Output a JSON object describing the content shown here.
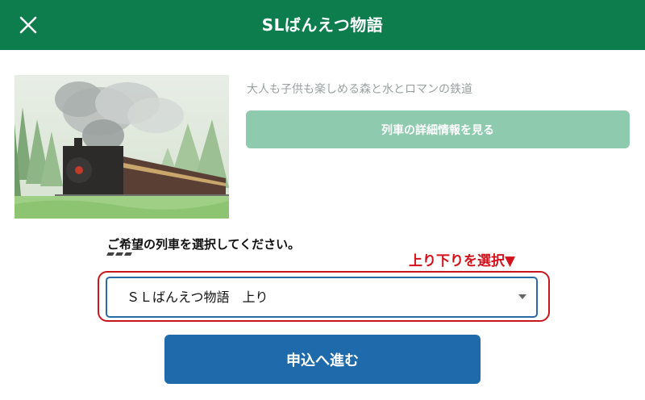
{
  "header": {
    "title": "SLばんえつ物語",
    "close_icon": "close-icon",
    "background_color": "#0e7d4e"
  },
  "train_info": {
    "image_description_icon": "steam-locomotive-photo",
    "subtitle": "大人も子供も楽しめる森と水とロマンの鉄道",
    "detail_button_label": "列車の詳細情報を見る",
    "detail_button_color": "#8ecbae"
  },
  "selection": {
    "instruction": "ご希望の列車を選択してください。",
    "annotation": "上り下りを選択▼",
    "annotation_color": "#d4121c",
    "selected_value": "ＳＬばんえつ物語　上り",
    "dropdown_icon": "chevron-down-icon"
  },
  "submit": {
    "label": "申込へ進む",
    "color": "#1f6aaa"
  }
}
